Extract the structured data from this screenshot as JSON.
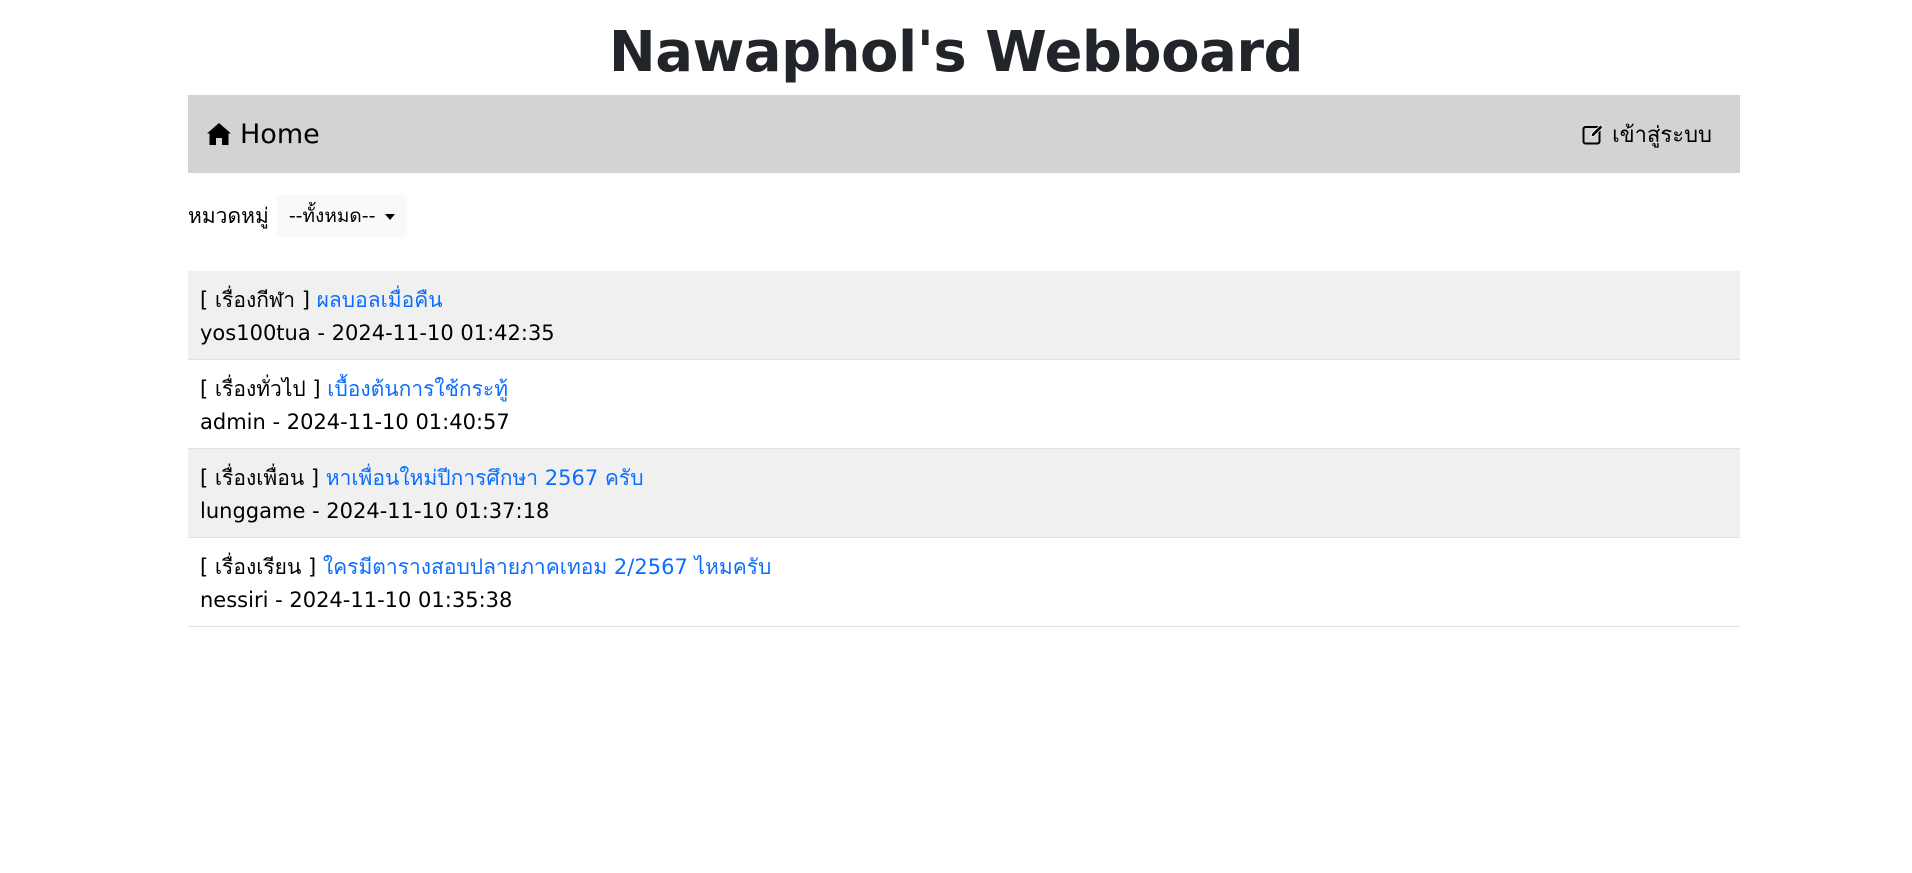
{
  "site": {
    "title": "Nawaphol's Webboard"
  },
  "navbar": {
    "home_icon": "house-icon",
    "home_label": "Home",
    "login_icon": "pencil-square-icon",
    "login_label": "เข้าสู่ระบบ"
  },
  "filter": {
    "label": "หมวดหมู่",
    "selected": "--ทั้งหมด--"
  },
  "topics": [
    {
      "category": "[ เรื่องกีฬา ]",
      "title": "ผลบอลเมื่อคืน",
      "meta": "yos100tua - 2024-11-10 01:42:35"
    },
    {
      "category": "[ เรื่องทั่วไป ]",
      "title": "เบื้องต้นการใช้กระทู้",
      "meta": "admin - 2024-11-10 01:40:57"
    },
    {
      "category": "[ เรื่องเพื่อน ]",
      "title": "หาเพื่อนใหม่ปีการศึกษา 2567 ครับ",
      "meta": "lunggame - 2024-11-10 01:37:18"
    },
    {
      "category": "[ เรื่องเรียน ]",
      "title": "ใครมีตารางสอบปลายภาคเทอม 2/2567 ไหมครับ",
      "meta": "nessiri - 2024-11-10 01:35:38"
    }
  ],
  "colors": {
    "navbar_bg": "#d3d3d3",
    "link": "#0d6efd",
    "row_stripe": "#f0f0f0"
  }
}
